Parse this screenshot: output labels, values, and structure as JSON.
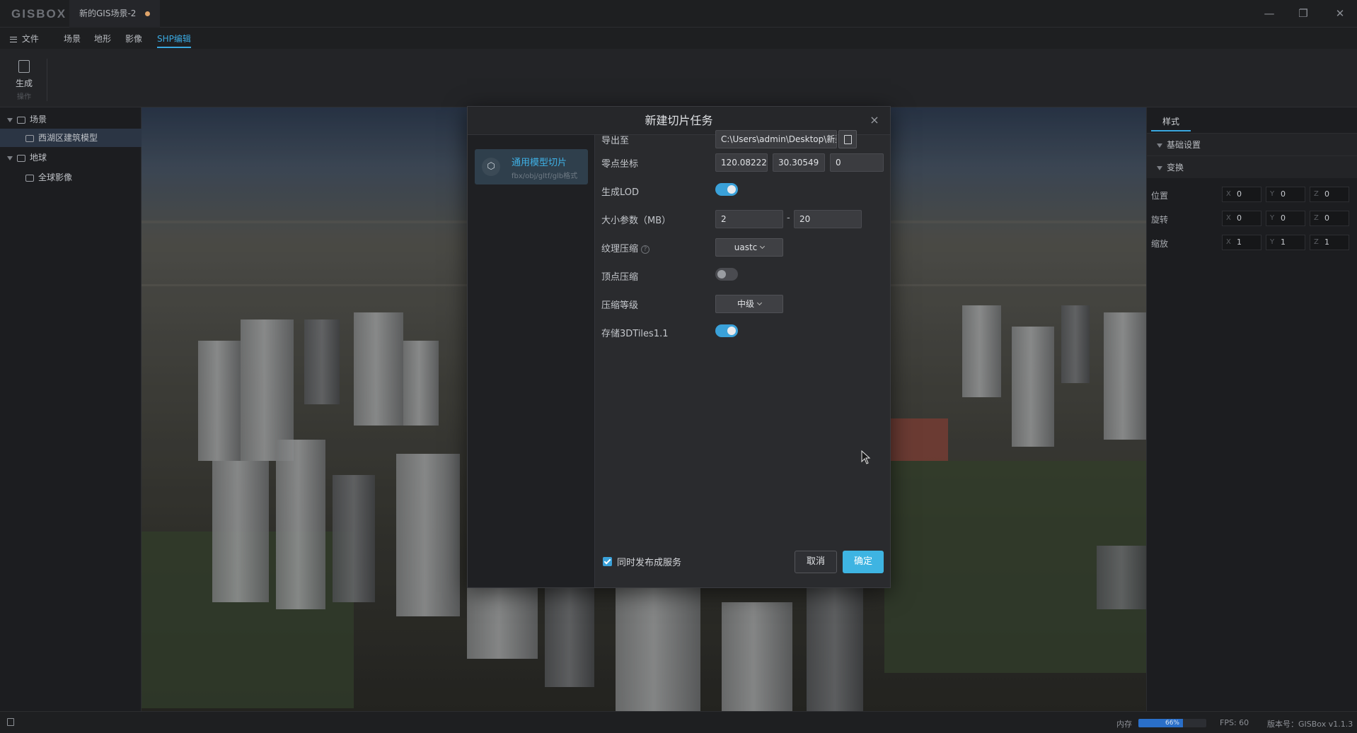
{
  "titlebar": {
    "logo": "GISBOX",
    "doc_tab": "新的GIS场景-2",
    "minimize": "—",
    "restore": "❐",
    "close": "✕"
  },
  "menubar": {
    "file": "文件",
    "items": [
      "场景",
      "地形",
      "影像",
      "SHP编辑"
    ],
    "active": "SHP编辑"
  },
  "toolbar": {
    "generate_label": "生成",
    "generate_sub": "操作"
  },
  "left_panel": {
    "items": [
      {
        "label": "场景",
        "level": 0
      },
      {
        "label": "西湖区建筑模型",
        "level": 1,
        "selected": true
      },
      {
        "label": "地球",
        "level": 0
      },
      {
        "label": "全球影像",
        "level": 1
      }
    ]
  },
  "right_panel": {
    "tab": "样式",
    "section_basic": "基础设置",
    "section_transform": "变换",
    "rows": [
      {
        "label": "位置",
        "x": "0",
        "y": "0",
        "z": "0"
      },
      {
        "label": "旋转",
        "x": "0",
        "y": "0",
        "z": "0"
      },
      {
        "label": "缩放",
        "x": "1",
        "y": "1",
        "z": "1"
      }
    ],
    "axis_x": "X",
    "axis_y": "Y",
    "axis_z": "Z"
  },
  "dialog": {
    "title": "新建切片任务",
    "close": "×",
    "side_card_title": "通用模型切片",
    "side_card_sub": "fbx/obj/gltf/glb格式",
    "fields": {
      "export_label": "导出至",
      "export_value": "C:\\Users\\admin\\Desktop\\新建文件夹",
      "origin_label": "零点坐标",
      "origin_x": "120.08222",
      "origin_y": "30.30549",
      "origin_z": "0",
      "lod_label": "生成LOD",
      "lod_on": true,
      "size_label": "大小参数（MB）",
      "size_min": "2",
      "size_max": "20",
      "size_dash": "-",
      "texture_label": "纹理压缩",
      "texture_value": "uastc",
      "help": "?",
      "vertex_label": "顶点压缩",
      "vertex_on": false,
      "level_label": "压缩等级",
      "level_value": "中级",
      "tiles_label": "存储3DTiles1.1",
      "tiles_on": true
    },
    "publish_label": "同时发布成服务",
    "publish_checked": true,
    "cancel": "取消",
    "ok": "确定"
  },
  "statusbar": {
    "memory_label": "内存",
    "memory_value": "66%",
    "memory_fraction": 0.66,
    "fps": "FPS: 60",
    "version": "版本号：GISBox v1.1.3"
  },
  "colors": {
    "accent": "#3aa8e0",
    "ok_button": "#3eb4e2",
    "selected_row": "#2b3544"
  }
}
